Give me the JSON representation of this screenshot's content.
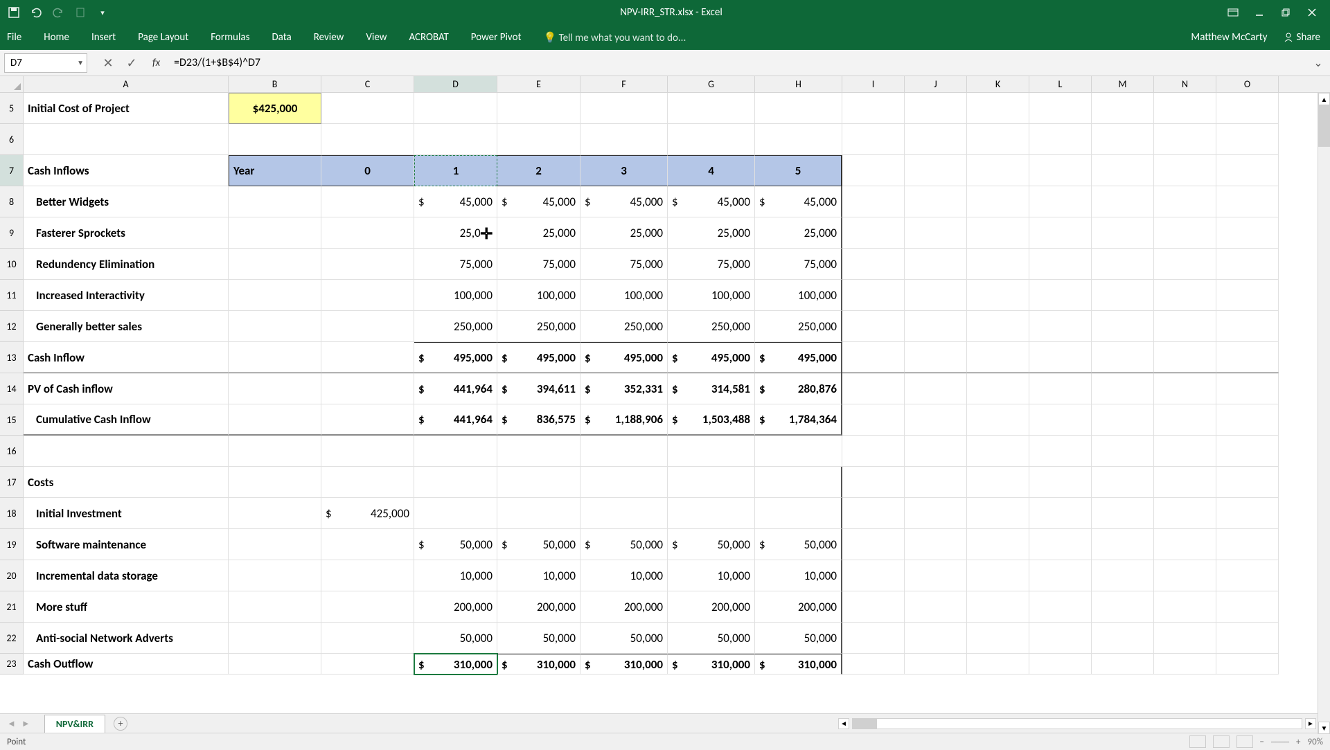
{
  "app": {
    "title": "NPV-IRR_STR.xlsx - Excel"
  },
  "ribbon": {
    "tabs": [
      "File",
      "Home",
      "Insert",
      "Page Layout",
      "Formulas",
      "Data",
      "Review",
      "View",
      "ACROBAT",
      "Power Pivot"
    ],
    "tell_me": "Tell me what you want to do...",
    "user": "Matthew McCarty",
    "share": "Share"
  },
  "formula": {
    "name_box": "D7",
    "value": "=D23/(1+$B$4)^D7"
  },
  "columns": [
    "A",
    "B",
    "C",
    "D",
    "E",
    "F",
    "G",
    "H",
    "I",
    "J",
    "K",
    "L",
    "M",
    "N",
    "O"
  ],
  "rows": {
    "r5": {
      "n": "5",
      "a": "Initial Cost of Project",
      "b": "$425,000"
    },
    "r6": {
      "n": "6"
    },
    "r7": {
      "n": "7",
      "a": "Cash Inflows",
      "b": "Year",
      "c": "0",
      "d": "1",
      "e": "2",
      "f": "3",
      "g": "4",
      "h": "5"
    },
    "r8": {
      "n": "8",
      "a": "Better Widgets",
      "d": "45,000",
      "e": "45,000",
      "f": "45,000",
      "g": "45,000",
      "h": "45,000"
    },
    "r9": {
      "n": "9",
      "a": "Fasterer Sprockets",
      "d": "25,000",
      "e": "25,000",
      "f": "25,000",
      "g": "25,000",
      "h": "25,000"
    },
    "r10": {
      "n": "10",
      "a": "Redundency Elimination",
      "d": "75,000",
      "e": "75,000",
      "f": "75,000",
      "g": "75,000",
      "h": "75,000"
    },
    "r11": {
      "n": "11",
      "a": "Increased Interactivity",
      "d": "100,000",
      "e": "100,000",
      "f": "100,000",
      "g": "100,000",
      "h": "100,000"
    },
    "r12": {
      "n": "12",
      "a": "Generally better sales",
      "d": "250,000",
      "e": "250,000",
      "f": "250,000",
      "g": "250,000",
      "h": "250,000"
    },
    "r13": {
      "n": "13",
      "a": "Cash Inflow",
      "d": "495,000",
      "e": "495,000",
      "f": "495,000",
      "g": "495,000",
      "h": "495,000"
    },
    "r14": {
      "n": "14",
      "a": "PV of Cash inflow",
      "d": "441,964",
      "e": "394,611",
      "f": "352,331",
      "g": "314,581",
      "h": "280,876"
    },
    "r15": {
      "n": "15",
      "a": "Cumulative Cash Inflow",
      "d": "441,964",
      "e": "836,575",
      "f": "1,188,906",
      "g": "1,503,488",
      "h": "1,784,364"
    },
    "r16": {
      "n": "16"
    },
    "r17": {
      "n": "17",
      "a": "Costs"
    },
    "r18": {
      "n": "18",
      "a": "Initial Investment",
      "c": "425,000"
    },
    "r19": {
      "n": "19",
      "a": "Software maintenance",
      "d": "50,000",
      "e": "50,000",
      "f": "50,000",
      "g": "50,000",
      "h": "50,000"
    },
    "r20": {
      "n": "20",
      "a": "Incremental data storage",
      "d": "10,000",
      "e": "10,000",
      "f": "10,000",
      "g": "10,000",
      "h": "10,000"
    },
    "r21": {
      "n": "21",
      "a": "More stuff",
      "d": "200,000",
      "e": "200,000",
      "f": "200,000",
      "g": "200,000",
      "h": "200,000"
    },
    "r22": {
      "n": "22",
      "a": "Anti-social Network Adverts",
      "d": "50,000",
      "e": "50,000",
      "f": "50,000",
      "g": "50,000",
      "h": "50,000"
    },
    "r23": {
      "n": "23",
      "a": "Cash Outflow",
      "d": "310,000",
      "e": "310,000",
      "f": "310,000",
      "g": "310,000",
      "h": "310,000"
    }
  },
  "sheet": {
    "active": "NPV&IRR"
  },
  "status": {
    "mode": "Point",
    "zoom": "90%"
  }
}
